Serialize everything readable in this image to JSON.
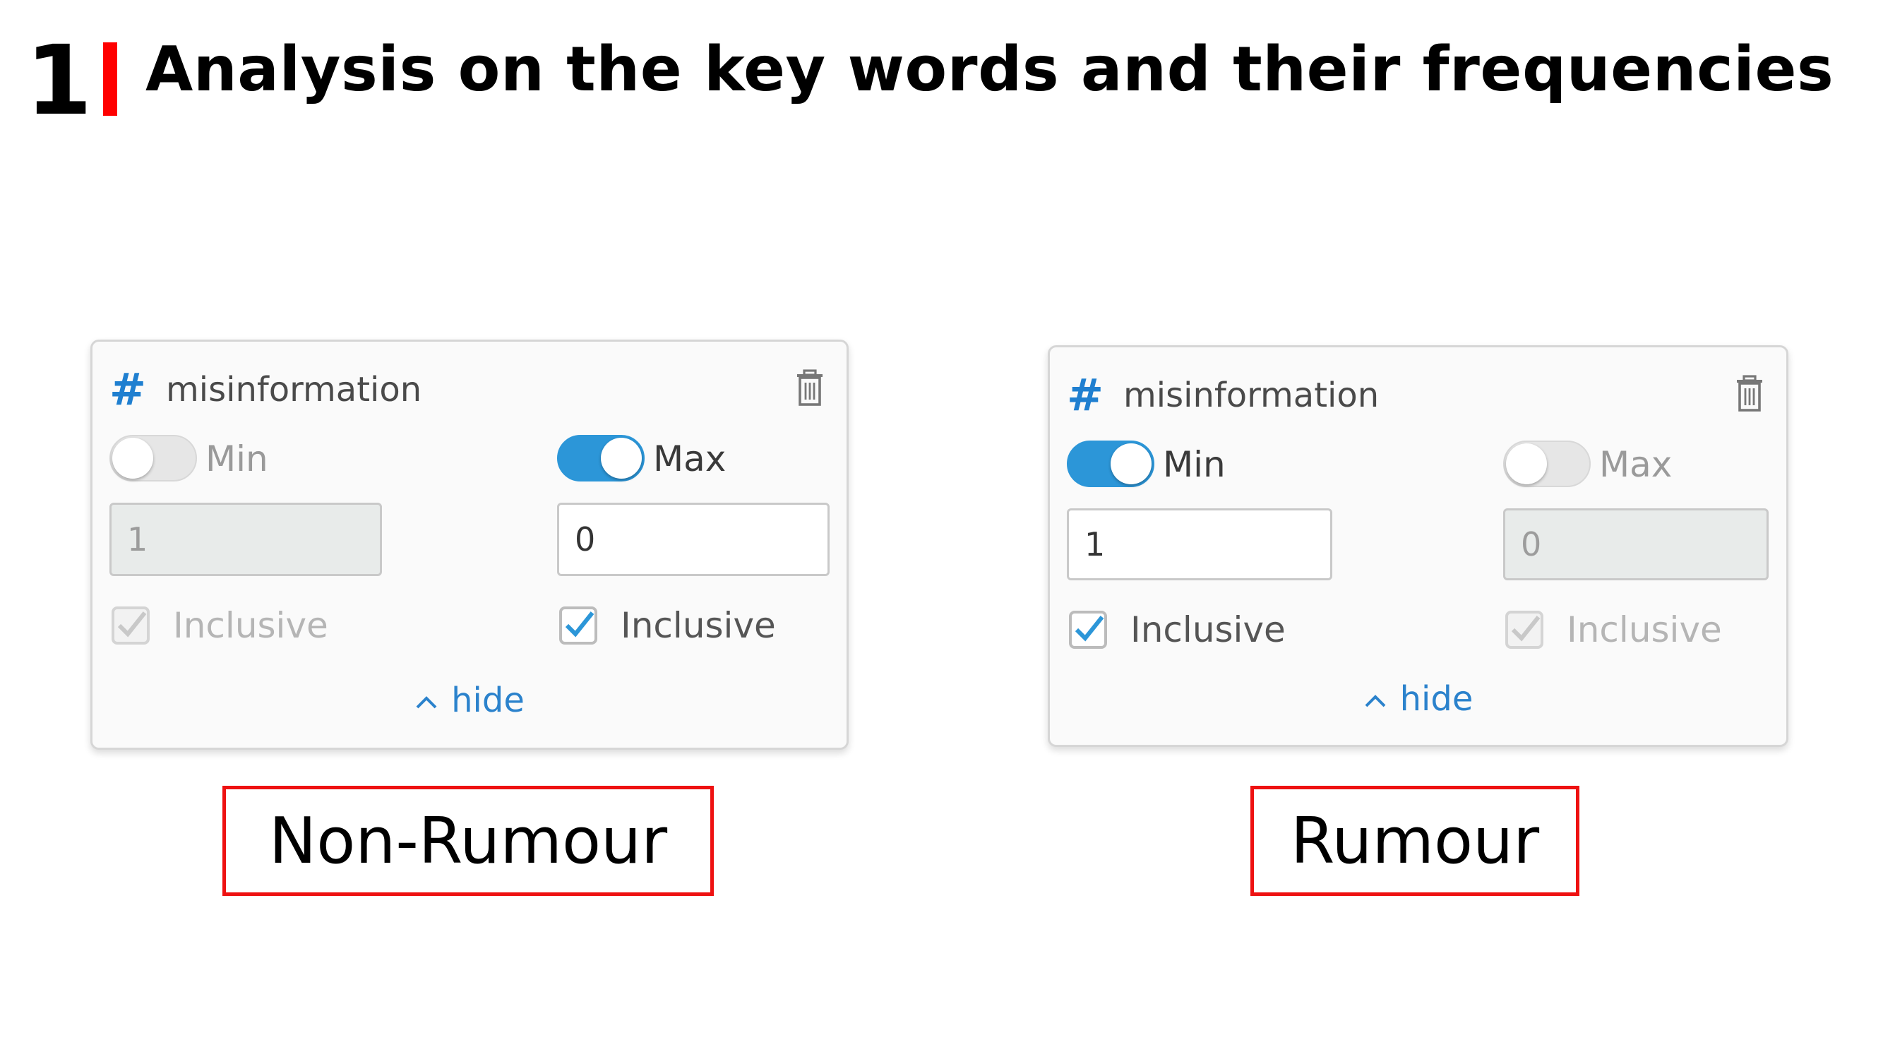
{
  "slide": {
    "number": "1",
    "title": "Analysis on the key words and their frequencies"
  },
  "cards": [
    {
      "field_name": "misinformation",
      "min": {
        "label": "Min",
        "enabled": false,
        "value": "1",
        "inclusive_label": "Inclusive",
        "inclusive_checked": true
      },
      "max": {
        "label": "Max",
        "enabled": true,
        "value": "0",
        "inclusive_label": "Inclusive",
        "inclusive_checked": true
      },
      "hide_label": "hide",
      "caption": "Non-Rumour"
    },
    {
      "field_name": "misinformation",
      "min": {
        "label": "Min",
        "enabled": true,
        "value": "1",
        "inclusive_label": "Inclusive",
        "inclusive_checked": true
      },
      "max": {
        "label": "Max",
        "enabled": false,
        "value": "0",
        "inclusive_label": "Inclusive",
        "inclusive_checked": true
      },
      "hide_label": "hide",
      "caption": "Rumour"
    }
  ],
  "colors": {
    "accent": "#2c96d8",
    "link": "#2b82cc",
    "caption_border": "#ee1111",
    "title_bar": "#ff0000"
  },
  "icons": [
    "hash-icon",
    "trash-icon",
    "chevron-up-icon",
    "checkbox-checked-icon"
  ]
}
